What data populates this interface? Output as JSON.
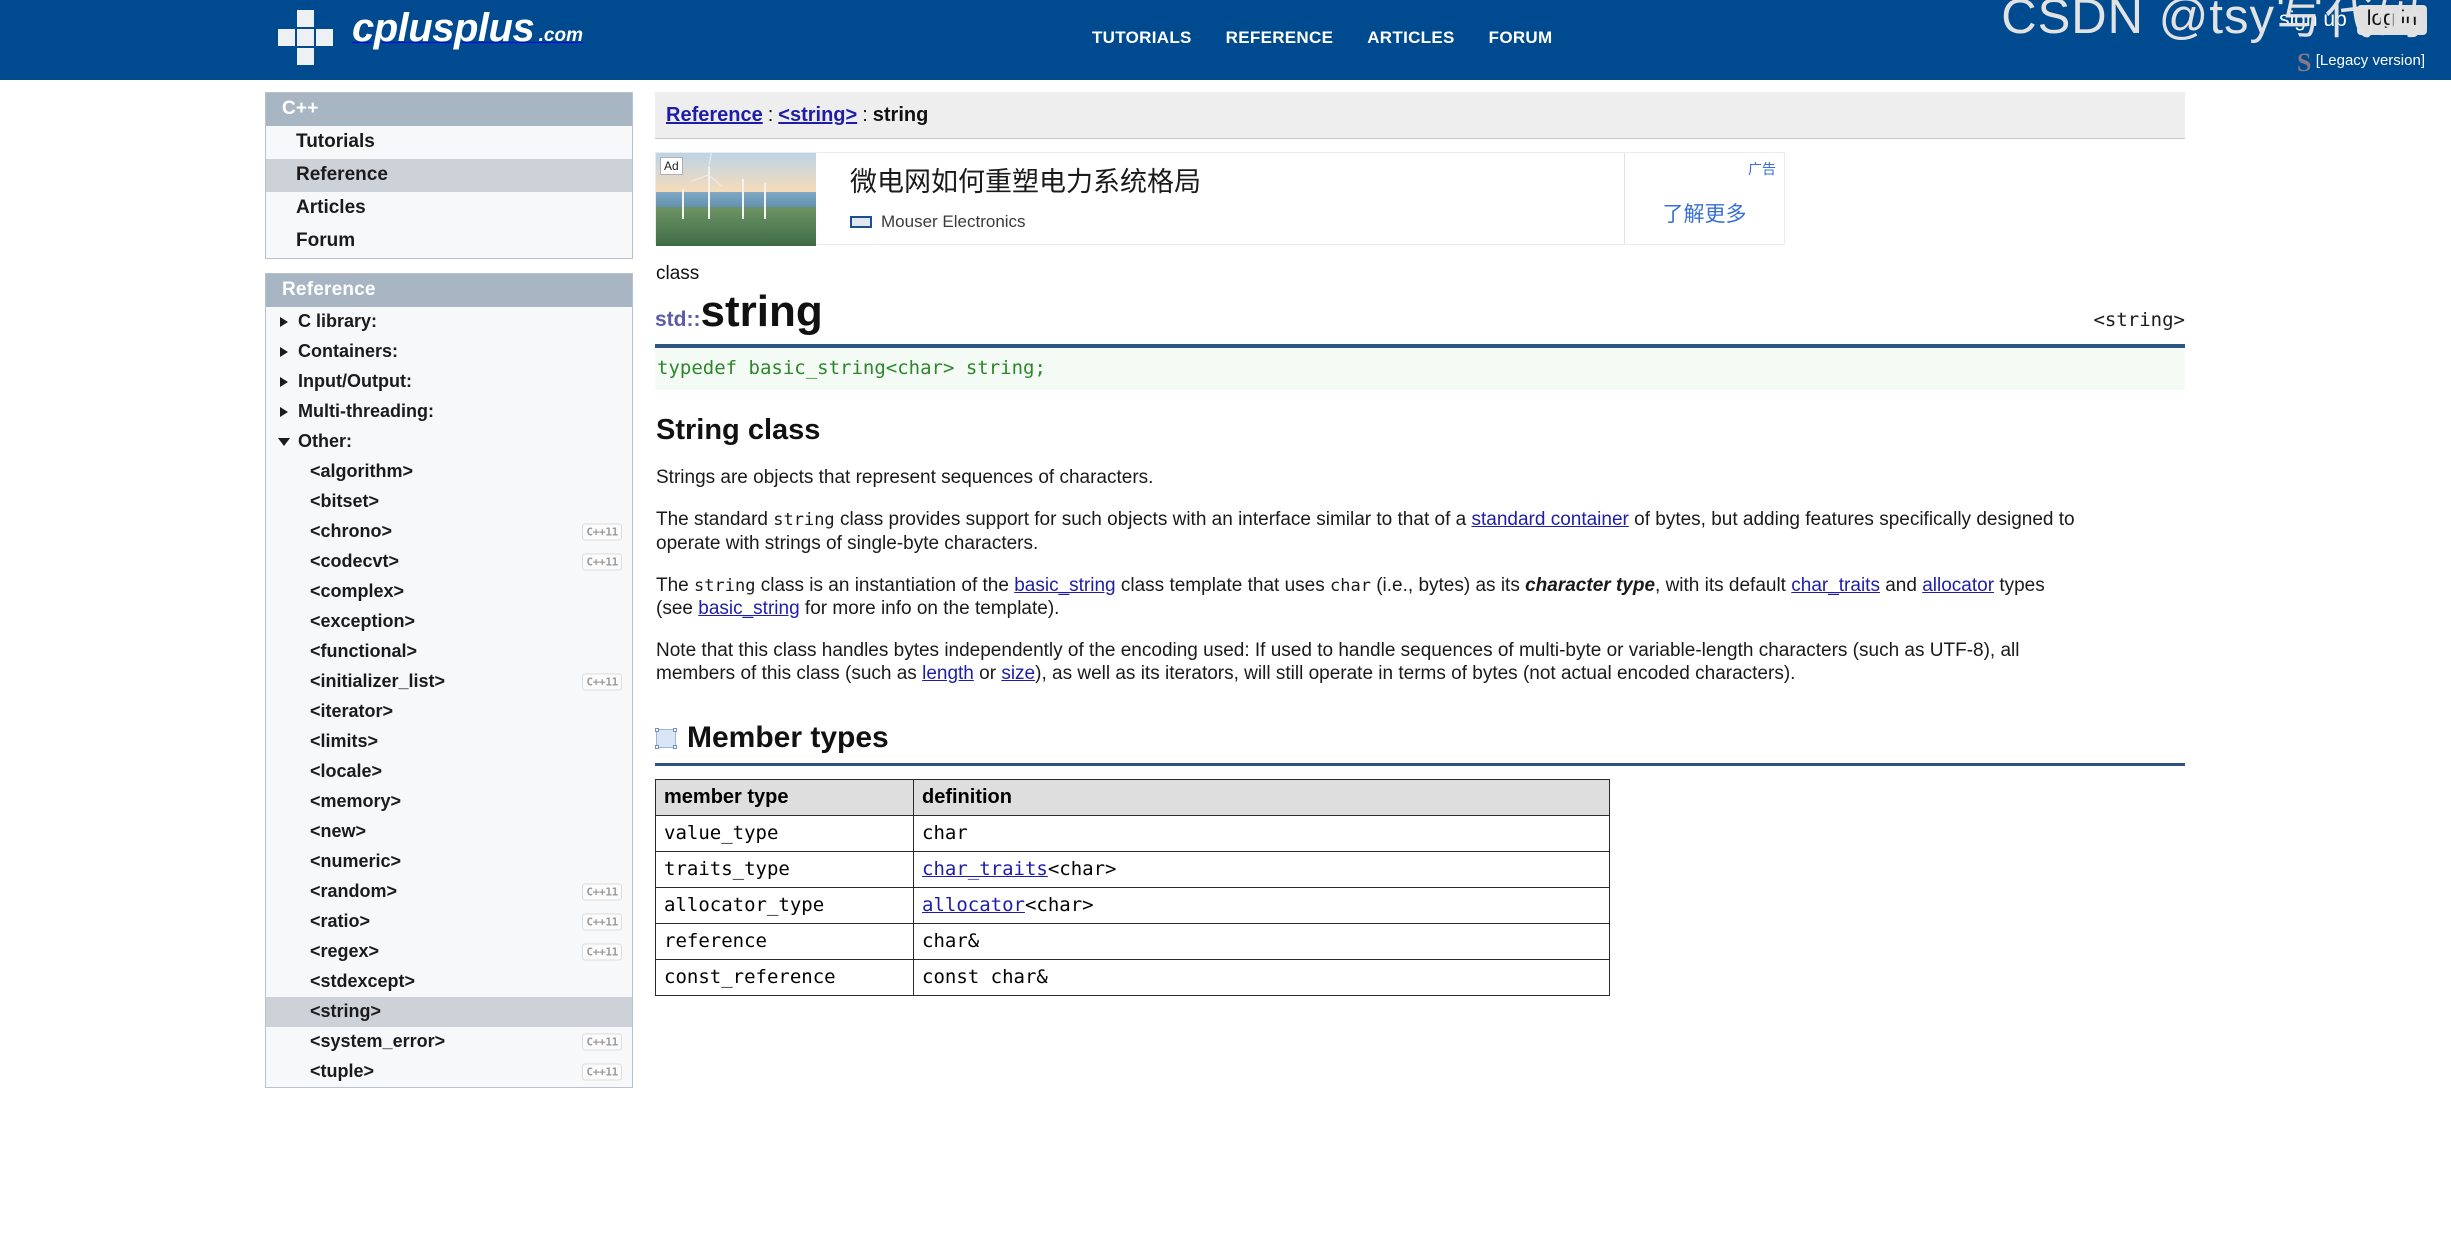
{
  "header": {
    "logo_name": "cplusplus",
    "logo_dotcom": ".com",
    "nav": [
      {
        "label": "TUTORIALS"
      },
      {
        "label": "REFERENCE"
      },
      {
        "label": "ARTICLES"
      },
      {
        "label": "FORUM"
      }
    ],
    "sign_up": "sign up",
    "log_in": "log in",
    "legacy": "[Legacy version]"
  },
  "sidebar": {
    "cpp_box": {
      "title": "C++",
      "items": [
        {
          "label": "Tutorials",
          "selected": false
        },
        {
          "label": "Reference",
          "selected": true
        },
        {
          "label": "Articles",
          "selected": false
        },
        {
          "label": "Forum",
          "selected": false
        }
      ]
    },
    "reference_box": {
      "title": "Reference",
      "groups": [
        {
          "label": "C library:",
          "open": false
        },
        {
          "label": "Containers:",
          "open": false
        },
        {
          "label": "Input/Output:",
          "open": false
        },
        {
          "label": "Multi-threading:",
          "open": false
        },
        {
          "label": "Other:",
          "open": true
        }
      ],
      "other_items": [
        {
          "label": "<algorithm>",
          "tag": "",
          "selected": false
        },
        {
          "label": "<bitset>",
          "tag": "",
          "selected": false
        },
        {
          "label": "<chrono>",
          "tag": "C++11",
          "selected": false
        },
        {
          "label": "<codecvt>",
          "tag": "C++11",
          "selected": false
        },
        {
          "label": "<complex>",
          "tag": "",
          "selected": false
        },
        {
          "label": "<exception>",
          "tag": "",
          "selected": false
        },
        {
          "label": "<functional>",
          "tag": "",
          "selected": false
        },
        {
          "label": "<initializer_list>",
          "tag": "C++11",
          "selected": false
        },
        {
          "label": "<iterator>",
          "tag": "",
          "selected": false
        },
        {
          "label": "<limits>",
          "tag": "",
          "selected": false
        },
        {
          "label": "<locale>",
          "tag": "",
          "selected": false
        },
        {
          "label": "<memory>",
          "tag": "",
          "selected": false
        },
        {
          "label": "<new>",
          "tag": "",
          "selected": false
        },
        {
          "label": "<numeric>",
          "tag": "",
          "selected": false
        },
        {
          "label": "<random>",
          "tag": "C++11",
          "selected": false
        },
        {
          "label": "<ratio>",
          "tag": "C++11",
          "selected": false
        },
        {
          "label": "<regex>",
          "tag": "C++11",
          "selected": false
        },
        {
          "label": "<stdexcept>",
          "tag": "",
          "selected": false
        },
        {
          "label": "<string>",
          "tag": "",
          "selected": true
        },
        {
          "label": "<system_error>",
          "tag": "C++11",
          "selected": false
        },
        {
          "label": "<tuple>",
          "tag": "C++11",
          "selected": false
        }
      ]
    }
  },
  "breadcrumb": {
    "reference": "Reference",
    "sep1": ":",
    "header_file": "<string>",
    "sep2": ":",
    "current": "string"
  },
  "ad": {
    "badge": "Ad",
    "title": "微电网如何重塑电力系统格局",
    "advertiser": "Mouser Electronics",
    "label": "广告",
    "cta": "了解更多"
  },
  "article": {
    "kind": "class",
    "namespace": "std::",
    "name": "string",
    "header_file": "<string>",
    "typedef_code": "typedef basic_string<char> string;",
    "section_title": "String class",
    "p1": "Strings are objects that represent sequences of characters.",
    "p2_a": "The standard ",
    "p2_code": "string",
    "p2_b": " class provides support for such objects with an interface similar to that of a ",
    "p2_link": "standard container",
    "p2_c": " of bytes, but adding features specifically designed to operate with strings of single-byte characters.",
    "p3_a": "The ",
    "p3_code1": "string",
    "p3_b": " class is an instantiation of the ",
    "p3_link1": "basic_string",
    "p3_c": " class template that uses ",
    "p3_code2": "char",
    "p3_d": " (i.e., bytes) as its ",
    "p3_em": "character type",
    "p3_e": ", with its default ",
    "p3_link2": "char_traits",
    "p3_f": " and ",
    "p3_link3": "allocator",
    "p3_g": " types (see ",
    "p3_link4": "basic_string",
    "p3_h": " for more info on the template).",
    "p4_a": "Note that this class handles bytes independently of the encoding used: If used to handle sequences of multi-byte or variable-length characters (such as UTF-8), all members of this class (such as ",
    "p4_link1": "length",
    "p4_b": " or ",
    "p4_link2": "size",
    "p4_c": "), as well as its iterators, will still operate in terms of bytes (not actual encoded characters)."
  },
  "member_types": {
    "heading": "Member types",
    "columns": [
      "member type",
      "definition"
    ],
    "rows": [
      {
        "member": "value_type",
        "def_link": "",
        "def_rest": "char"
      },
      {
        "member": "traits_type",
        "def_link": "char_traits",
        "def_rest": "<char>"
      },
      {
        "member": "allocator_type",
        "def_link": "allocator",
        "def_rest": "<char>"
      },
      {
        "member": "reference",
        "def_link": "",
        "def_rest": "char&"
      },
      {
        "member": "const_reference",
        "def_link": "",
        "def_rest": "const char&"
      }
    ]
  },
  "watermark": {
    "text": "CSDN @tsy写代码"
  }
}
